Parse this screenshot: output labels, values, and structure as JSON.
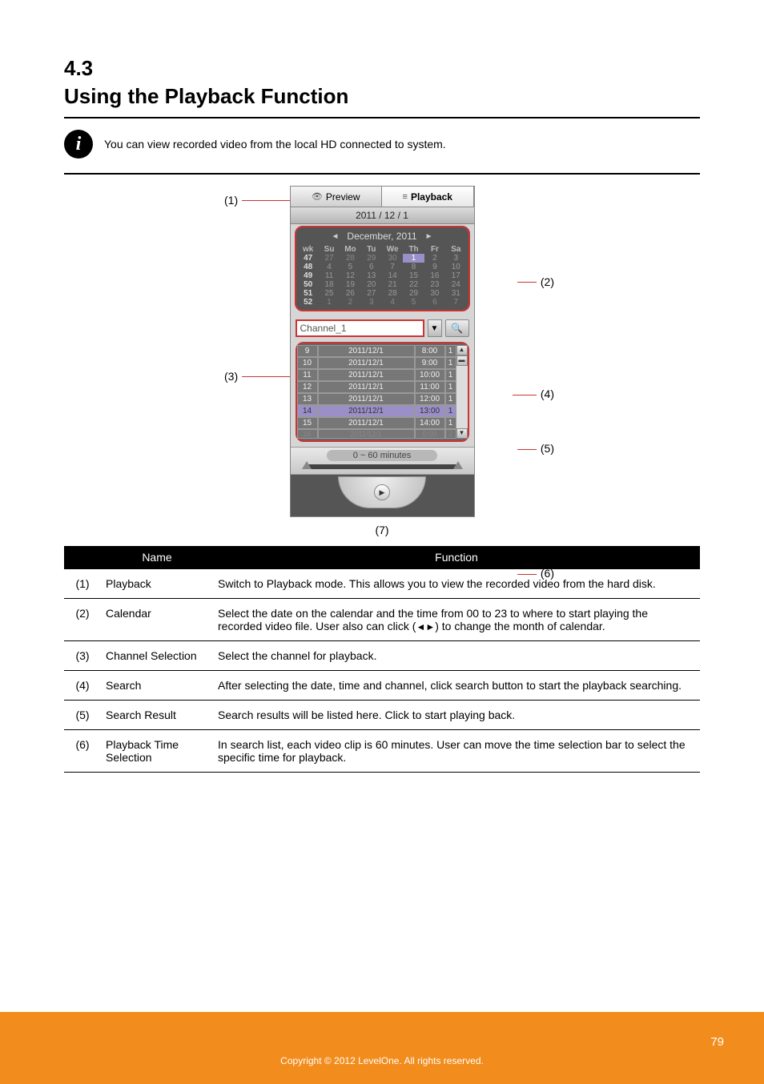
{
  "section_number": "4.3",
  "section_title": "Using the Playback Function",
  "info_text": "You can view recorded video from the local HD connected to system.",
  "tabs": {
    "preview": "Preview",
    "playback": "Playback"
  },
  "date_header": "2011 / 12 / 1",
  "calendar": {
    "month_label": "December, 2011",
    "wk_hdr": "wk",
    "dow": [
      "Su",
      "Mo",
      "Tu",
      "We",
      "Th",
      "Fr",
      "Sa"
    ],
    "weeks": [
      {
        "wk": "47",
        "days": [
          "27",
          "28",
          "29",
          "30",
          "1",
          "2",
          "3"
        ],
        "sel": 4
      },
      {
        "wk": "48",
        "days": [
          "4",
          "5",
          "6",
          "7",
          "8",
          "9",
          "10"
        ]
      },
      {
        "wk": "49",
        "days": [
          "11",
          "12",
          "13",
          "14",
          "15",
          "16",
          "17"
        ]
      },
      {
        "wk": "50",
        "days": [
          "18",
          "19",
          "20",
          "21",
          "22",
          "23",
          "24"
        ]
      },
      {
        "wk": "51",
        "days": [
          "25",
          "26",
          "27",
          "28",
          "29",
          "30",
          "31"
        ]
      },
      {
        "wk": "52",
        "days": [
          "1",
          "2",
          "3",
          "4",
          "5",
          "6",
          "7"
        ]
      }
    ]
  },
  "channel_select": "Channel_1",
  "results": [
    {
      "n": "9",
      "d": "2011/12/1",
      "t": "8:00",
      "c": "1"
    },
    {
      "n": "10",
      "d": "2011/12/1",
      "t": "9:00",
      "c": "1"
    },
    {
      "n": "11",
      "d": "2011/12/1",
      "t": "10:00",
      "c": "1"
    },
    {
      "n": "12",
      "d": "2011/12/1",
      "t": "11:00",
      "c": "1"
    },
    {
      "n": "13",
      "d": "2011/12/1",
      "t": "12:00",
      "c": "1"
    },
    {
      "n": "14",
      "d": "2011/12/1",
      "t": "13:00",
      "c": "1",
      "sel": true
    },
    {
      "n": "15",
      "d": "2011/12/1",
      "t": "14:00",
      "c": "1"
    },
    {
      "n": "16",
      "d": "2011/12/1",
      "t": "0:00",
      "c": "2",
      "last": true
    }
  ],
  "slider_label": "0 ~ 60 minutes",
  "callouts": {
    "c1": "(1)",
    "c2": "(2)",
    "c3": "(3)",
    "c4": "(4)",
    "c5": "(5)",
    "c6": "(6)",
    "c7": "(7)"
  },
  "table": {
    "headers": [
      "Name",
      "Function"
    ],
    "rows": [
      {
        "num": "(1)",
        "name": "Playback",
        "fn": "Switch to Playback mode. This allows you to view the recorded video from the hard disk."
      },
      {
        "num": "(2)",
        "name": "Calendar",
        "fn_pre": "Select the date on the calendar and the time from 00 to 23 to where to start playing the recorded video file. User also can click ",
        "fn_mid": " (",
        "fn_arrows": "◄►",
        "fn_post": ") to change the month of calendar."
      },
      {
        "num": "(3)",
        "name": "Channel Selection",
        "fn": "Select the channel for playback."
      },
      {
        "num": "(4)",
        "name": "Search",
        "fn": "After selecting the date, time and channel, click search button to start the playback searching."
      },
      {
        "num": "(5)",
        "name": "Search Result",
        "fn": "Search results will be listed here. Click to start playing back."
      },
      {
        "num": "(6)",
        "name": "Playback Time Selection",
        "fn": "In search list, each video clip is 60 minutes. User can move the time selection bar to select the specific time for playback."
      }
    ]
  },
  "footer": {
    "page": "79",
    "copyright": "Copyright © 2012 LevelOne. All rights reserved."
  }
}
